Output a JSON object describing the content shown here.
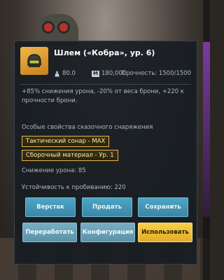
{
  "item": {
    "name": "Шлем («Кобра», ур. 6)",
    "icon": "helmet-icon",
    "weight": "80.0",
    "price": "180,000",
    "price_icon_letter": "M",
    "durability": "Прочность: 1500/1500"
  },
  "description": "+85% снижения урона, -20% от веса брони, +220 к прочности брони.",
  "special": {
    "title": "Особые свойства сказочного снаряжения",
    "tags": [
      "Тактический сонар - MAX",
      "Сборочный материал - Ур. 1"
    ]
  },
  "stats": {
    "damage_reduction": "Снижение урона: 85",
    "penetration_resistance": "Устойчивость к пробиванию: 220"
  },
  "buttons": {
    "workbench": "Верстак",
    "sell": "Продать",
    "save": "Сохранить",
    "rework": "Переработать",
    "config": "Конфигурация",
    "use": "Использовать"
  },
  "colors": {
    "accent_gold": "#e3b547",
    "button_blue": "#4ea5c6",
    "button_primary": "#f8cf4c"
  }
}
